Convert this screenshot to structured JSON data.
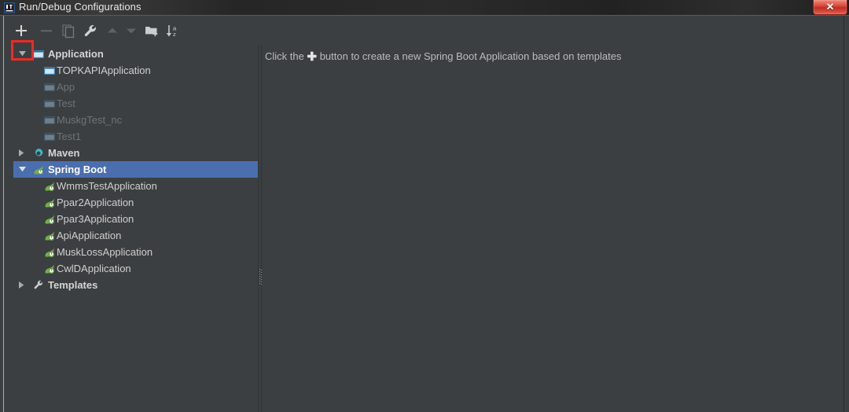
{
  "window": {
    "title": "Run/Debug Configurations",
    "app_icon": "intellij-idea-icon",
    "close_label": "✕",
    "accent_highlight": "#f02a22",
    "selection_color": "#4b6eaf",
    "background": "#3c3f41"
  },
  "toolbar": {
    "buttons": [
      {
        "name": "add-configuration-button",
        "icon": "plus-icon",
        "label": "+",
        "enabled": true,
        "highlighted": true
      },
      {
        "name": "remove-configuration-button",
        "icon": "minus-icon",
        "label": "−",
        "enabled": false,
        "highlighted": false
      },
      {
        "name": "copy-configuration-button",
        "icon": "copy-icon",
        "label": "Copy",
        "enabled": false,
        "highlighted": false
      },
      {
        "name": "edit-templates-button",
        "icon": "wrench-icon",
        "label": "Edit Templates",
        "enabled": true,
        "highlighted": false
      },
      {
        "name": "move-up-button",
        "icon": "arrow-up-icon",
        "label": "Move Up",
        "enabled": false,
        "highlighted": false
      },
      {
        "name": "move-down-button",
        "icon": "arrow-down-icon",
        "label": "Move Down",
        "enabled": false,
        "highlighted": false
      },
      {
        "name": "move-into-folder-button",
        "icon": "folder-add-icon",
        "label": "Create Folder",
        "enabled": true,
        "highlighted": false
      },
      {
        "name": "sort-configurations-button",
        "icon": "sort-alpha-icon",
        "label": "Sort Configurations",
        "enabled": true,
        "highlighted": false
      }
    ]
  },
  "tree": {
    "groups": [
      {
        "label": "Application",
        "icon": "application-icon",
        "expanded": true,
        "selected": false,
        "children": [
          {
            "label": "TOPKAPIApplication",
            "icon": "application-icon",
            "dim": false
          },
          {
            "label": "App",
            "icon": "application-icon",
            "dim": true
          },
          {
            "label": "Test",
            "icon": "application-icon",
            "dim": true
          },
          {
            "label": "MuskgTest_nc",
            "icon": "application-icon",
            "dim": true
          },
          {
            "label": "Test1",
            "icon": "application-icon",
            "dim": true
          }
        ]
      },
      {
        "label": "Maven",
        "icon": "maven-gear-icon",
        "expanded": false,
        "selected": false,
        "children": []
      },
      {
        "label": "Spring Boot",
        "icon": "spring-boot-icon",
        "expanded": true,
        "selected": true,
        "children": [
          {
            "label": "WmmsTestApplication",
            "icon": "spring-boot-icon",
            "dim": false
          },
          {
            "label": "Ppar2Application",
            "icon": "spring-boot-icon",
            "dim": false
          },
          {
            "label": "Ppar3Application",
            "icon": "spring-boot-icon",
            "dim": false
          },
          {
            "label": "ApiApplication",
            "icon": "spring-boot-icon",
            "dim": false
          },
          {
            "label": "MuskLossApplication",
            "icon": "spring-boot-icon",
            "dim": false
          },
          {
            "label": "CwlDApplication",
            "icon": "spring-boot-icon",
            "dim": false
          }
        ]
      },
      {
        "label": "Templates",
        "icon": "wrench-icon",
        "expanded": false,
        "selected": false,
        "children": []
      }
    ]
  },
  "detail": {
    "hint_before": "Click the",
    "hint_plus": "✚",
    "hint_after": "button to create a new Spring Boot Application based on templates"
  }
}
